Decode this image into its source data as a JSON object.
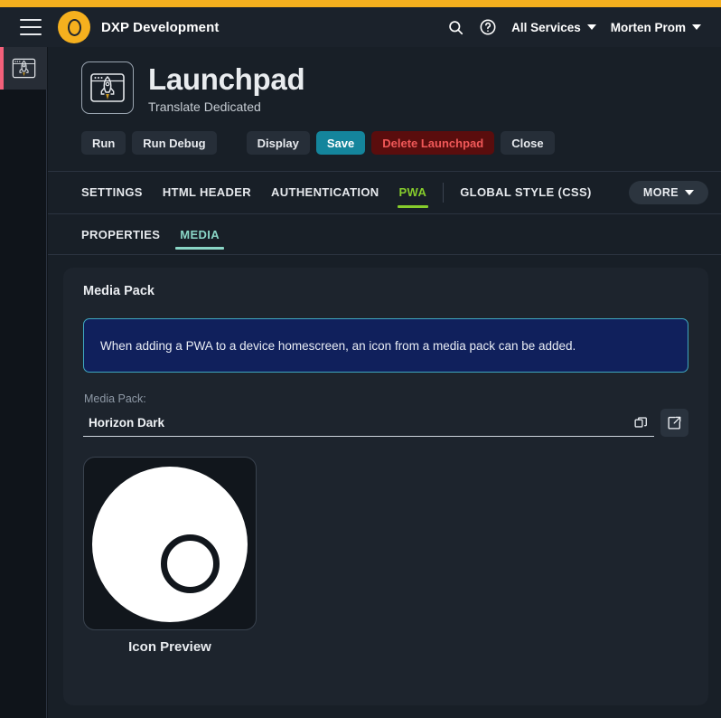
{
  "theme": {
    "accent_strip": "#f5b01e",
    "brand_yellow": "#f5b01e",
    "active_tab_green": "#86cc2c",
    "active_subtab_teal": "#8ad6c6",
    "save_teal": "#14859c",
    "danger_red": "#f05858",
    "rail_marker_pink": "#f4607a",
    "notice_bg": "#10205c",
    "notice_border": "#3fa8c0",
    "card_bg": "#1d242d",
    "page_bg": "#181f27"
  },
  "topbar": {
    "menu_icon": "hamburger-icon",
    "logo_icon": "brand-circle-logo",
    "brand": "DXP Development",
    "search_icon": "search-icon",
    "help_icon": "help-circle-icon",
    "all_services": "All Services",
    "user_name": "Morten Prom",
    "chevron_icon": "chevron-down-icon"
  },
  "rail": {
    "items": [
      {
        "name": "launchpad",
        "icon": "rocket-window-icon",
        "active": true
      }
    ]
  },
  "page": {
    "icon": "rocket-window-icon",
    "title": "Launchpad",
    "subtitle": "Translate Dedicated"
  },
  "actions": [
    {
      "label": "Run",
      "style": "default"
    },
    {
      "label": "Run Debug",
      "style": "default"
    },
    {
      "label": "Display",
      "style": "default"
    },
    {
      "label": "Save",
      "style": "save"
    },
    {
      "label": "Delete Launchpad",
      "style": "danger"
    },
    {
      "label": "Close",
      "style": "default"
    }
  ],
  "tabs": [
    {
      "label": "SETTINGS",
      "active": false
    },
    {
      "label": "HTML HEADER",
      "active": false
    },
    {
      "label": "AUTHENTICATION",
      "active": false
    },
    {
      "label": "PWA",
      "active": true
    },
    {
      "label": "GLOBAL STYLE (CSS)",
      "active": false
    }
  ],
  "more_button": {
    "label": "MORE",
    "icon": "chevron-down-icon"
  },
  "subtabs": [
    {
      "label": "PROPERTIES",
      "active": false
    },
    {
      "label": "MEDIA",
      "active": true
    }
  ],
  "card": {
    "title": "Media Pack",
    "notice": "When adding a PWA to a device homescreen, an icon from a media pack can be added.",
    "field": {
      "label": "Media Pack:",
      "value": "Horizon Dark",
      "placeholder": "",
      "inline_icon": "copy-icon",
      "side_button_icon": "open-external-icon"
    },
    "preview": {
      "caption": "Icon Preview",
      "icon_description": "white-disc-with-ring"
    }
  }
}
